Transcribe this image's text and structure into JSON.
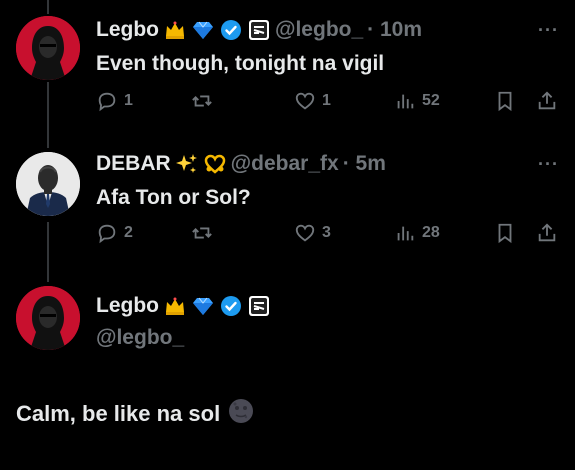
{
  "colors": {
    "background": "#000000",
    "text": "#e7e9ea",
    "muted": "#71767b",
    "verified": "#1d9bf0",
    "avatar_red": "#c8102e"
  },
  "replies": [
    {
      "name": "Legbo",
      "emojis": [
        "crown-icon",
        "gem-icon",
        "verified-icon",
        "affiliate-badge-icon"
      ],
      "handle": "@legbo_",
      "time": "· 10m",
      "text": "Even though, tonight na vigil",
      "more": "···",
      "stats": {
        "replies": "1",
        "reposts": "",
        "likes": "1",
        "views": "52"
      }
    },
    {
      "name": "DEBAR",
      "emojis": [
        "sparkles-icon",
        "heart-hands-icon"
      ],
      "handle": "@debar_fx",
      "time": "· 5m",
      "text": "Afa Ton or Sol?",
      "more": "···",
      "stats": {
        "replies": "2",
        "reposts": "",
        "likes": "3",
        "views": "28"
      }
    }
  ],
  "main_post": {
    "name": "Legbo",
    "emojis": [
      "crown-icon",
      "gem-icon",
      "verified-icon",
      "affiliate-badge-icon"
    ],
    "handle": "@legbo_",
    "text": "Calm, be like na sol",
    "emoji": "new-moon-face-icon"
  }
}
